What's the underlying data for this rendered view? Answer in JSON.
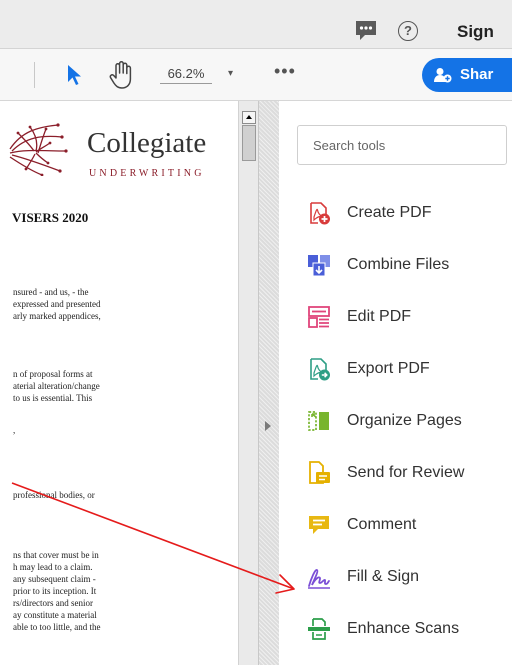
{
  "topbar": {
    "chat_icon": "comment-bubble-icon",
    "help_label": "?",
    "signin_label": "Sign"
  },
  "toolbar": {
    "select_icon": "arrow-cursor-icon",
    "hand_icon": "hand-tool-icon",
    "zoom": "66.2%",
    "zoom_dropdown": "▾",
    "more": "•••",
    "share_label": "Shar",
    "share_color": "#1473e6"
  },
  "document": {
    "logo_name": "Collegiate",
    "logo_sub": "UNDERWRITING",
    "logo_color": "#8b1e2a",
    "heading": "VISERS 2020",
    "lines": [
      "nsured - and us, - the",
      "expressed and presented",
      "arly marked appendices,",
      "n of proposal forms at",
      "aterial alteration/change",
      "to us is essential. This",
      ",",
      "professional bodies, or",
      "ns that cover must be in",
      "h may lead to a claim.",
      "any subsequent claim -",
      "prior to its inception. It",
      "rs/directors and senior",
      "ay constitute a material",
      "able to too little, and the"
    ]
  },
  "tools_pane": {
    "search_placeholder": "Search tools",
    "items": [
      {
        "label": "Create PDF",
        "icon": "create-pdf-icon",
        "color": "#d83b3b"
      },
      {
        "label": "Combine Files",
        "icon": "combine-files-icon",
        "color": "#4a5fd8"
      },
      {
        "label": "Edit PDF",
        "icon": "edit-pdf-icon",
        "color": "#e0457b"
      },
      {
        "label": "Export PDF",
        "icon": "export-pdf-icon",
        "color": "#2e9e85"
      },
      {
        "label": "Organize Pages",
        "icon": "organize-pages-icon",
        "color": "#78b52e"
      },
      {
        "label": "Send for Review",
        "icon": "send-for-review-icon",
        "color": "#e5b100"
      },
      {
        "label": "Comment",
        "icon": "comment-icon",
        "color": "#e8b812"
      },
      {
        "label": "Fill & Sign",
        "icon": "fill-sign-icon",
        "color": "#7b4fd6"
      },
      {
        "label": "Enhance Scans",
        "icon": "enhance-scans-icon",
        "color": "#2c9e4a"
      }
    ]
  },
  "annotation": {
    "color": "#e51b1b"
  }
}
